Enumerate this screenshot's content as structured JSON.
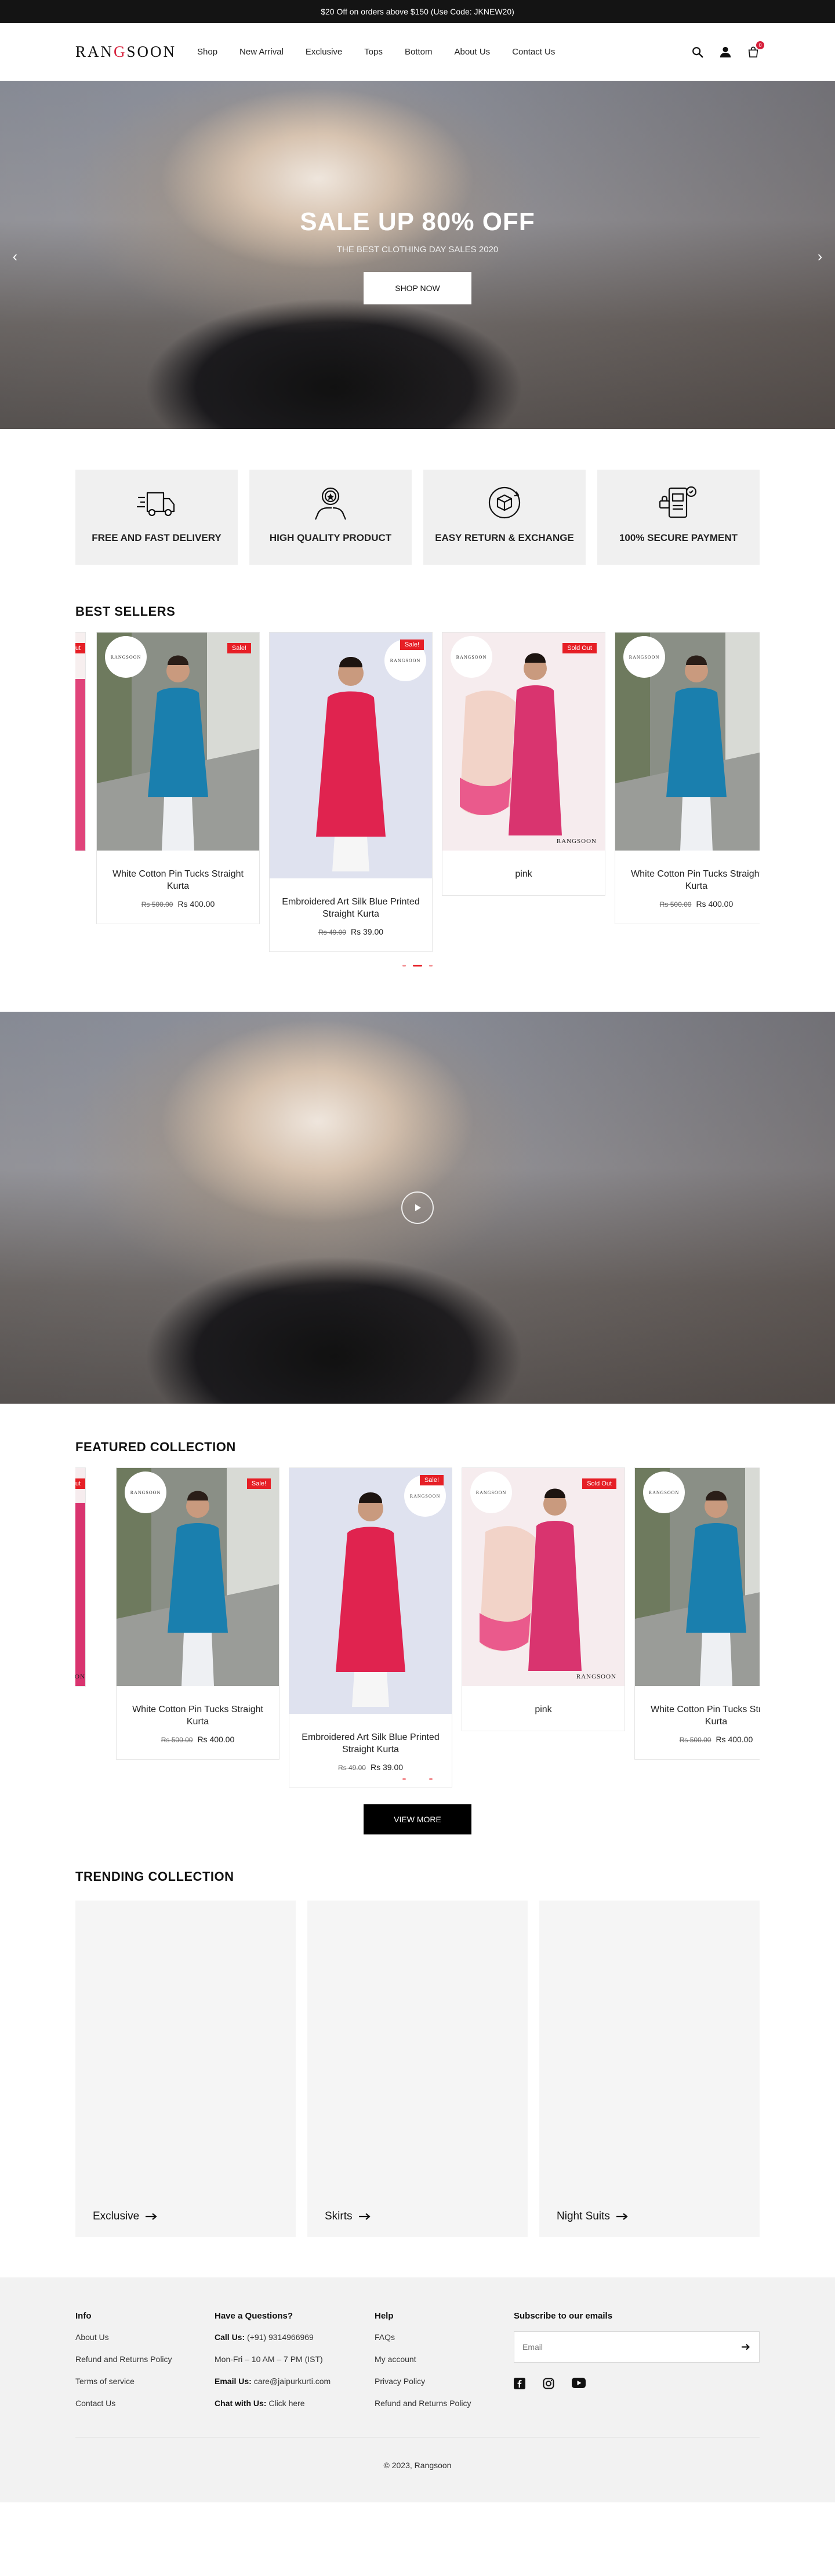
{
  "announcement": "$20 Off on orders above $150 (Use Code: JKNEW20)",
  "header": {
    "logo_left": "RAN",
    "logo_accent": "G",
    "logo_right": "SOON",
    "nav": [
      "Shop",
      "New Arrival",
      "Exclusive",
      "Tops",
      "Bottom",
      "About Us",
      "Contact Us"
    ],
    "cart_count": "0",
    "icons": [
      "search-icon",
      "user-icon",
      "cart-icon"
    ]
  },
  "hero": {
    "title": "SALE UP 80% OFF",
    "subtitle": "THE BEST CLOTHING DAY SALES 2020",
    "button": "SHOP NOW"
  },
  "features": [
    {
      "label": "FREE AND FAST DELIVERY",
      "icon": "truck-icon"
    },
    {
      "label": "HIGH QUALITY PRODUCT",
      "icon": "quality-badge-icon"
    },
    {
      "label": "EASY RETURN & EXCHANGE",
      "icon": "return-box-icon"
    },
    {
      "label": "100% SECURE PAYMENT",
      "icon": "secure-payment-icon"
    }
  ],
  "best_sellers": {
    "title": "BEST SELLERS",
    "products": [
      {
        "name": "White Cotton Pin Tucks Straight Kurta",
        "old_price": "Rs 500.00",
        "price": "Rs 400.00",
        "tag": "Sale!",
        "brand": "RANGSOON"
      },
      {
        "name": "Embroidered Art Silk Blue Printed Straight Kurta",
        "old_price": "Rs 49.00",
        "price": "Rs 39.00",
        "tag": "Sale!",
        "brand": "RANGSOON"
      },
      {
        "name": "pink",
        "old_price": "",
        "price": "",
        "tag": "Sold Out",
        "brand": "RANGSOON"
      },
      {
        "name": "White Cotton Pin Tucks Straight Kurta",
        "old_price": "Rs 500.00",
        "price": "Rs 400.00",
        "tag": "",
        "brand": "RANGSOON"
      }
    ]
  },
  "featured": {
    "title": "FEATURED COLLECTION",
    "products": [
      {
        "name": "White Cotton Pin Tucks Straight Kurta",
        "old_price": "Rs 500.00",
        "price": "Rs 400.00",
        "tag": "Sale!",
        "brand": "RANGSOON"
      },
      {
        "name": "Embroidered Art Silk Blue Printed Straight Kurta",
        "old_price": "Rs 49.00",
        "price": "Rs 39.00",
        "tag": "Sale!",
        "brand": "RANGSOON"
      },
      {
        "name": "pink",
        "old_price": "",
        "price": "",
        "tag": "Sold Out",
        "brand": "RANGSOON"
      },
      {
        "name": "White Cotton Pin Tucks Straight Kurta",
        "old_price": "Rs 500.00",
        "price": "Rs 400.00",
        "tag": "",
        "brand": "RANGSOON"
      }
    ],
    "view_more": "VIEW MORE"
  },
  "trending": {
    "title": "TRENDING COLLECTION",
    "items": [
      "Exclusive",
      "Skirts",
      "Night Suits"
    ]
  },
  "footer": {
    "info": {
      "title": "Info",
      "links": [
        "About Us",
        "Refund and Returns Policy",
        "Terms of service",
        "Contact Us"
      ]
    },
    "questions": {
      "title": "Have a Questions?",
      "call_label": "Call Us:",
      "call_value": "(+91) 9314966969",
      "hours": "Mon-Fri – 10 AM – 7 PM (IST)",
      "email_label": "Email Us:",
      "email_value": "care@jaipurkurti.com",
      "chat_label": "Chat with Us:",
      "chat_value": "Click here"
    },
    "help": {
      "title": "Help",
      "links": [
        "FAQs",
        "My account",
        "Privacy Policy",
        "Refund and Returns Policy"
      ]
    },
    "subscribe": {
      "title": "Subscribe to our emails",
      "placeholder": "Email"
    },
    "social_icons": [
      "facebook-icon",
      "instagram-icon",
      "youtube-icon"
    ],
    "copyright": "© 2023, Rangsoon"
  },
  "colors": {
    "accent": "#e61f26",
    "dark": "#141414",
    "feature_bg": "#f0f0f0"
  }
}
